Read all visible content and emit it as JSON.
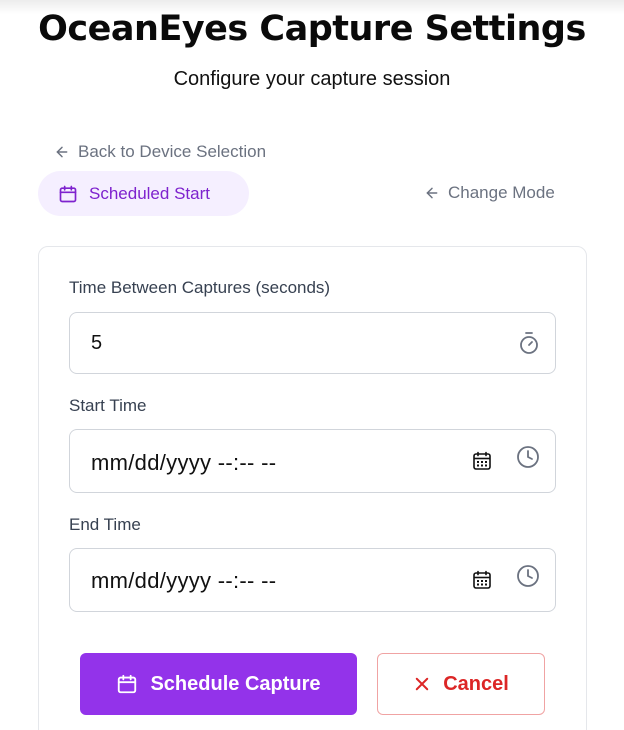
{
  "header": {
    "title": "OceanEyes Capture Settings",
    "subtitle": "Configure your capture session"
  },
  "nav": {
    "back_label": "Back to Device Selection",
    "mode_label": "Scheduled Start",
    "change_mode_label": "Change Mode"
  },
  "form": {
    "interval": {
      "label": "Time Between Captures (seconds)",
      "value": "5"
    },
    "start": {
      "label": "Start Time",
      "value": "mm/dd/yyyy --:-- --"
    },
    "end": {
      "label": "End Time",
      "value": "mm/dd/yyyy --:-- --"
    }
  },
  "actions": {
    "schedule_label": "Schedule Capture",
    "cancel_label": "Cancel"
  },
  "icons": {
    "back": "arrow-left-icon",
    "mode": "calendar-icon",
    "change_mode": "arrow-left-icon",
    "interval": "timer-icon",
    "date_picker": "calendar-icon",
    "time_picker": "clock-icon",
    "schedule": "calendar-icon",
    "cancel": "x-icon"
  },
  "colors": {
    "accent": "#9333ea",
    "accent_text": "#7e22ce",
    "pill_bg": "#f5efff",
    "danger": "#dc2626",
    "muted": "#6b7280"
  }
}
